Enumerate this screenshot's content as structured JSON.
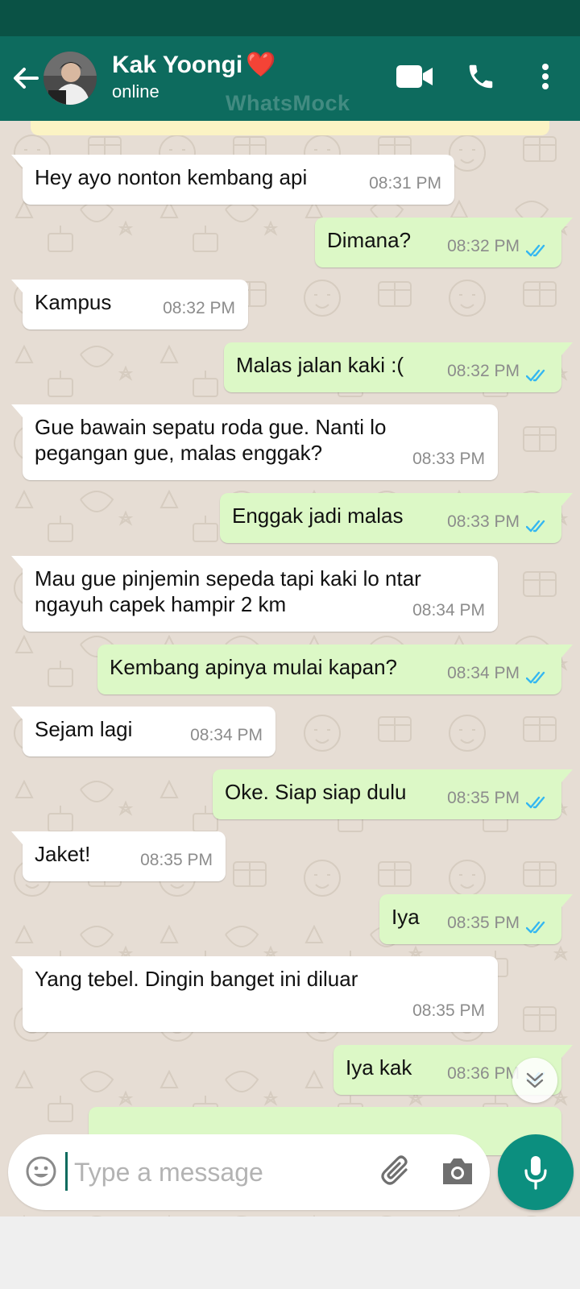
{
  "header": {
    "contact_name": "Kak Yoongi",
    "name_emoji": "❤️",
    "status": "online",
    "watermark": "WhatsMock"
  },
  "messages": [
    {
      "direction": "in",
      "text": "Hey ayo nonton kembang api",
      "time": "08:31 PM"
    },
    {
      "direction": "out",
      "text": "Dimana?",
      "time": "08:32 PM",
      "status": "read"
    },
    {
      "direction": "in",
      "text": "Kampus",
      "time": "08:32 PM"
    },
    {
      "direction": "out",
      "text": "Malas jalan kaki :(",
      "time": "08:32 PM",
      "status": "read"
    },
    {
      "direction": "in",
      "text": "Gue bawain sepatu roda gue. Nanti lo\npegangan gue, malas enggak?",
      "time": "08:33 PM"
    },
    {
      "direction": "out",
      "text": "Enggak jadi malas",
      "time": "08:33 PM",
      "status": "read"
    },
    {
      "direction": "in",
      "text": "Mau gue pinjemin sepeda tapi kaki lo ntar\nngayuh capek hampir 2 km",
      "time": "08:34 PM"
    },
    {
      "direction": "out",
      "text": "Kembang apinya mulai kapan?",
      "time": "08:34 PM",
      "status": "read"
    },
    {
      "direction": "in",
      "text": "Sejam lagi",
      "time": "08:34 PM"
    },
    {
      "direction": "out",
      "text": "Oke. Siap siap dulu",
      "time": "08:35 PM",
      "status": "read"
    },
    {
      "direction": "in",
      "text": "Jaket!",
      "time": "08:35 PM"
    },
    {
      "direction": "out",
      "text": "Iya",
      "time": "08:35 PM",
      "status": "read"
    },
    {
      "direction": "in",
      "text": "Yang tebel. Dingin banget ini diluar",
      "time": "08:35 PM"
    },
    {
      "direction": "out",
      "text": "Iya kak",
      "time": "08:36 PM",
      "status": "read"
    }
  ],
  "composer": {
    "placeholder": "Type a message"
  },
  "colors": {
    "header": "#0d6b5e",
    "status_bar": "#0a5245",
    "outgoing_bubble": "#dcf8c6",
    "incoming_bubble": "#ffffff",
    "read_tick": "#34b7f1",
    "mic_button": "#0c8f7f"
  },
  "icons": {
    "back": "arrow-left-icon",
    "video": "video-camera-icon",
    "call": "phone-icon",
    "more": "vertical-dots-icon",
    "emoji": "smiley-icon",
    "attach": "paperclip-icon",
    "camera": "camera-icon",
    "mic": "microphone-icon",
    "scroll_down": "double-chevron-down-icon",
    "read": "double-check-icon"
  }
}
